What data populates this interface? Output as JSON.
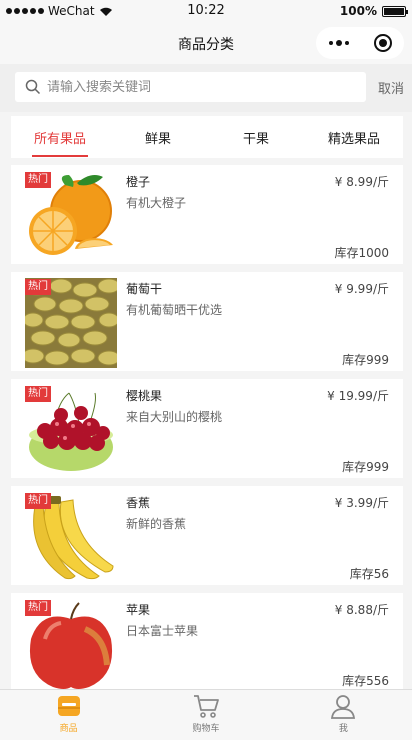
{
  "status_bar": {
    "carrier": "WeChat",
    "time": "10:22",
    "battery": "100%"
  },
  "nav": {
    "title": "商品分类"
  },
  "search": {
    "placeholder": "请输入搜索关键词",
    "cancel_label": "取消"
  },
  "tabs": [
    {
      "label": "所有果品",
      "active": true
    },
    {
      "label": "鲜果",
      "active": false
    },
    {
      "label": "干果",
      "active": false
    },
    {
      "label": "精选果品",
      "active": false
    }
  ],
  "products": [
    {
      "badge": "热门",
      "name": "橙子",
      "desc": "有机大橙子",
      "price": "¥ 8.99/斤",
      "stock": "库存1000",
      "image": "orange"
    },
    {
      "badge": "热门",
      "name": "葡萄干",
      "desc": "有机葡萄晒干优选",
      "price": "¥ 9.99/斤",
      "stock": "库存999",
      "image": "raisin"
    },
    {
      "badge": "热门",
      "name": "樱桃果",
      "desc": "来自大别山的樱桃",
      "price": "¥ 19.99/斤",
      "stock": "库存999",
      "image": "cherry"
    },
    {
      "badge": "热门",
      "name": "香蕉",
      "desc": "新鲜的香蕉",
      "price": "¥ 3.99/斤",
      "stock": "库存56",
      "image": "banana"
    },
    {
      "badge": "热门",
      "name": "苹果",
      "desc": "日本富士苹果",
      "price": "¥ 8.88/斤",
      "stock": "库存556",
      "image": "apple"
    }
  ],
  "tabbar": [
    {
      "label": "商品",
      "icon": "goods-icon",
      "active": true
    },
    {
      "label": "购物车",
      "icon": "cart-icon",
      "active": false
    },
    {
      "label": "我",
      "icon": "profile-icon",
      "active": false
    }
  ],
  "colors": {
    "accent_red": "#e33b3b",
    "tab_active": "#f5a623"
  }
}
